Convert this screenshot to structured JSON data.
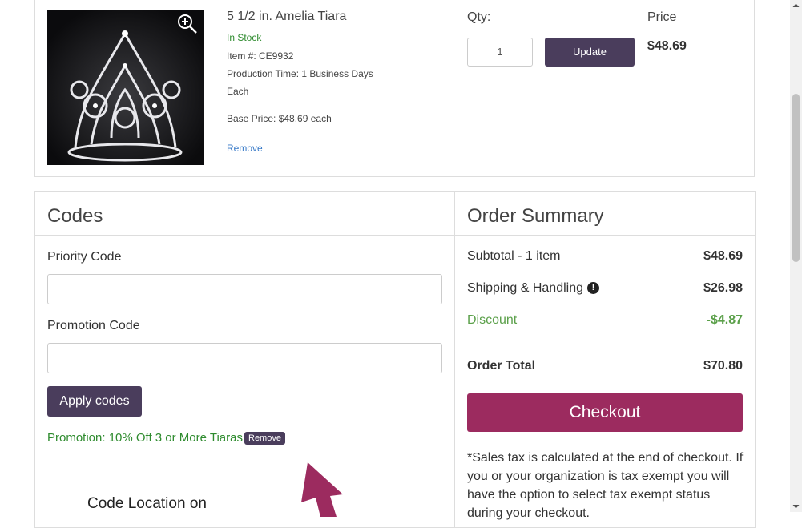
{
  "item": {
    "title": "5 1/2 in. Amelia Tiara",
    "stock_status": "In Stock",
    "item_number": "Item #: CE9932",
    "production_time": "Production Time: 1 Business Days",
    "unit": "Each",
    "base_price": "Base Price: $48.69 each",
    "remove_label": "Remove",
    "qty_label": "Qty:",
    "qty_value": "1",
    "update_label": "Update",
    "price_label": "Price",
    "price_value": "$48.69"
  },
  "codes": {
    "title": "Codes",
    "priority_label": "Priority Code",
    "priority_value": "",
    "promotion_label": "Promotion Code",
    "promotion_value": "",
    "apply_label": "Apply codes",
    "applied_promo": "Promotion: 10% Off 3 or More Tiaras",
    "promo_remove_label": "Remove",
    "code_location_text": "Code Location on"
  },
  "summary": {
    "title": "Order Summary",
    "subtotal_label": "Subtotal - 1 item",
    "subtotal_value": "$48.69",
    "shipping_label": "Shipping & Handling",
    "shipping_value": "$26.98",
    "discount_label": "Discount",
    "discount_value": "-$4.87",
    "total_label": "Order Total",
    "total_value": "$70.80",
    "checkout_label": "Checkout",
    "tax_note": "*Sales tax is calculated at the end of checkout. If you or your organization is tax exempt you will have the option to select tax exempt status during your checkout."
  },
  "colors": {
    "accent_button": "#4a3d5c",
    "checkout": "#9c2b5f",
    "success": "#2e8b2e",
    "discount": "#5ba04a",
    "link": "#3a7bc8"
  },
  "icons": {
    "zoom": "zoom-in-icon",
    "info": "info-icon",
    "arrow": "arrow-up-icon"
  }
}
